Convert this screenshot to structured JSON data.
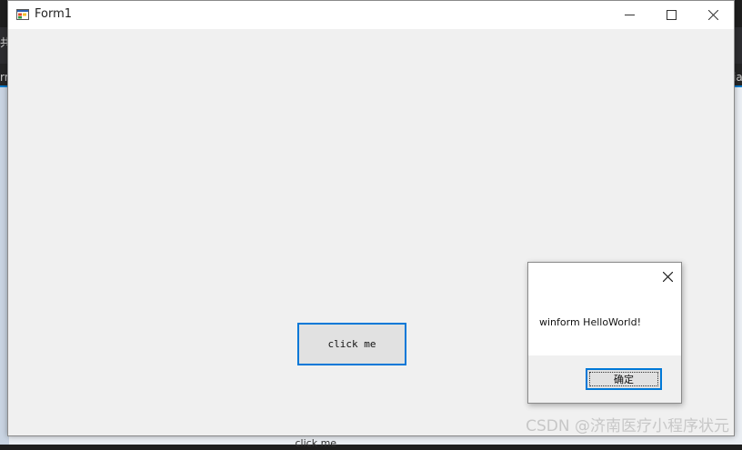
{
  "window": {
    "title": "Form1",
    "icon": "winforms-app-icon"
  },
  "main": {
    "button_label": "click me"
  },
  "message_box": {
    "message": "winform HelloWorld!",
    "ok_label": "确定"
  },
  "background": {
    "fragment_left_1": "共",
    "fragment_left_2": "rr",
    "fragment_right": "ia",
    "fragment_bottom": "   click me   "
  },
  "watermark": "CSDN @济南医疗小程序状元",
  "colors": {
    "accent": "#0078d7",
    "form_background": "#f0f0f0",
    "titlebar": "#ffffff"
  }
}
